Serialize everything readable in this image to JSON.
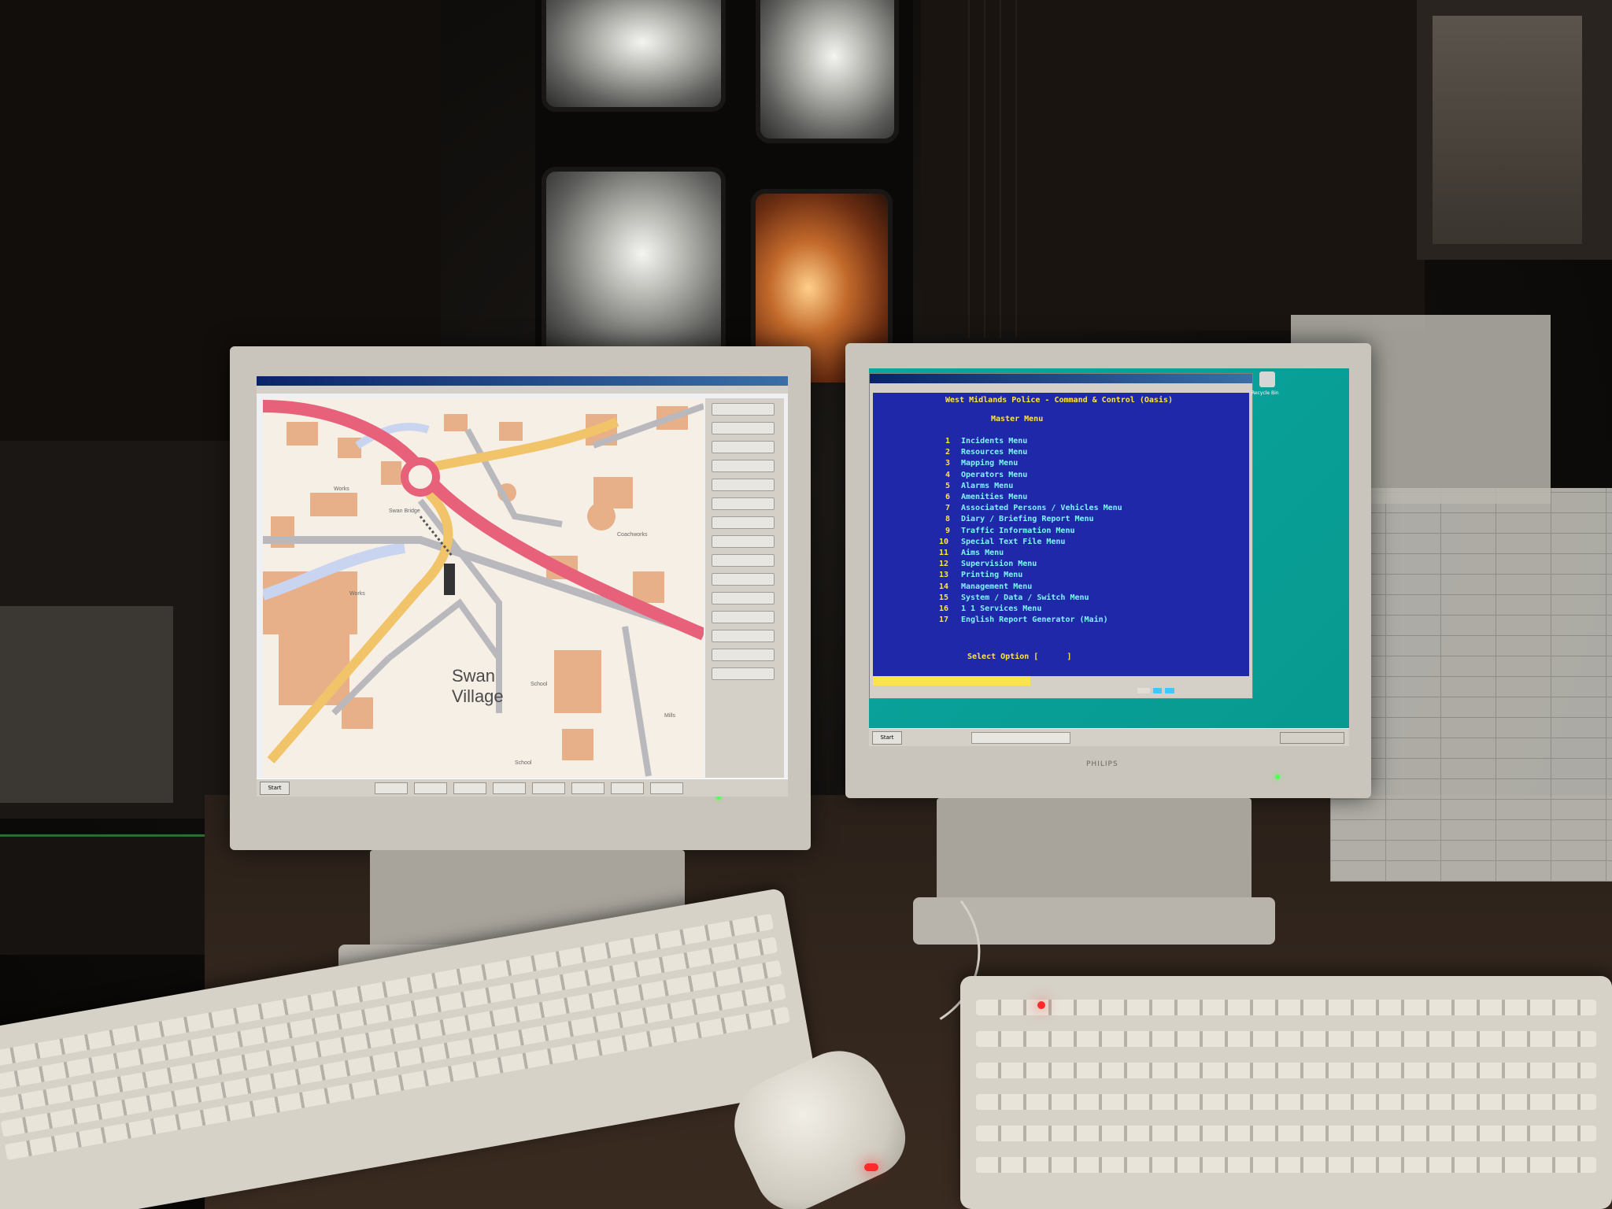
{
  "left_app": {
    "title": "",
    "menu": [],
    "map_labels": {
      "main_area_line1": "Swan",
      "main_area_line2": "Village",
      "school_1": "School",
      "school_2": "School",
      "works_1": "Works",
      "works_2": "Works",
      "swan_bridge": "Swan Bridge",
      "coachworks": "Coachworks",
      "rail": "",
      "mills": "Mills"
    },
    "sidebar_buttons": [],
    "taskbar": {
      "start_label": "Start"
    }
  },
  "right_app": {
    "window_title": "",
    "menu": [],
    "header_line": "West Midlands Police - Command & Control (Oasis)",
    "menu_title": "Master Menu",
    "account_line": "",
    "menu_items": [
      {
        "num": "1",
        "label": "Incidents Menu"
      },
      {
        "num": "2",
        "label": "Resources Menu"
      },
      {
        "num": "3",
        "label": "Mapping Menu"
      },
      {
        "num": "4",
        "label": "Operators Menu"
      },
      {
        "num": "5",
        "label": "Alarms Menu"
      },
      {
        "num": "6",
        "label": "Amenities Menu"
      },
      {
        "num": "7",
        "label": "Associated Persons / Vehicles Menu"
      },
      {
        "num": "8",
        "label": "Diary / Briefing Report Menu"
      },
      {
        "num": "9",
        "label": "Traffic Information Menu"
      },
      {
        "num": "10",
        "label": "Special Text File Menu"
      },
      {
        "num": "11",
        "label": "Aims Menu"
      },
      {
        "num": "12",
        "label": "Supervision Menu"
      },
      {
        "num": "13",
        "label": "Printing Menu"
      },
      {
        "num": "14",
        "label": "Management Menu"
      },
      {
        "num": "15",
        "label": "System / Data / Switch Menu"
      },
      {
        "num": "16",
        "label": "1 1 Services Menu"
      },
      {
        "num": "17",
        "label": "English Report Generator (Main)"
      }
    ],
    "prompt": "Select Option [      ]",
    "status_right": "",
    "status_bar": "",
    "desktop_icon_label": "Recycle Bin",
    "taskbar": {
      "start_label": "Start",
      "task_label": "",
      "clock": ""
    }
  },
  "colors": {
    "terminal_bg": "#1f28a8",
    "terminal_text": "#ffe34a",
    "desktop_teal": "#0aa6a0",
    "map_road_pink": "#e8617b",
    "map_road_yellow": "#f2c46a",
    "map_building": "#e8b088"
  }
}
